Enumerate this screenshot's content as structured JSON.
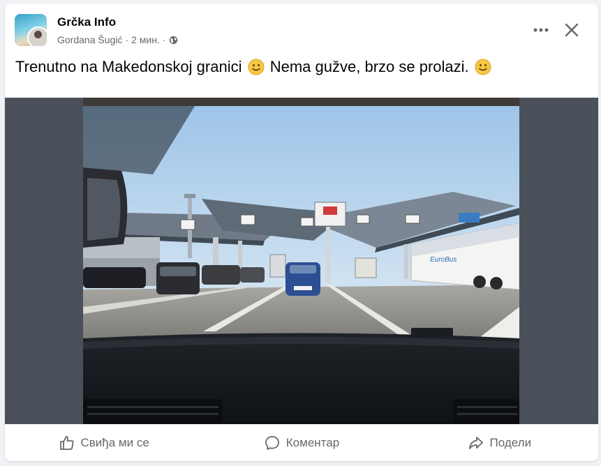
{
  "post": {
    "group_name": "Grčka Info",
    "author": "Gordana Šugić",
    "separator": "·",
    "time": "2 мин.",
    "text_part1": "Trenutno na Makedonskoj granici",
    "text_part2": "Nema gužve, brzo se prolazi.",
    "photo_signs": {
      "bus_brand": "EuroBus"
    }
  },
  "actions": {
    "like_label": "Свиђа ми се",
    "comment_label": "Коментар",
    "share_label": "Подели"
  },
  "colors": {
    "text_primary": "#050505",
    "text_secondary": "#65676b",
    "background": "#f0f2f5",
    "media_backdrop": "#4a5059"
  },
  "icons": {
    "more": "more-horizontal-icon",
    "close": "close-icon",
    "privacy": "globe-icon",
    "emoji": "slightly-smiling-face-icon",
    "like": "thumbs-up-icon",
    "comment": "comment-bubble-icon",
    "share": "share-arrow-icon"
  }
}
